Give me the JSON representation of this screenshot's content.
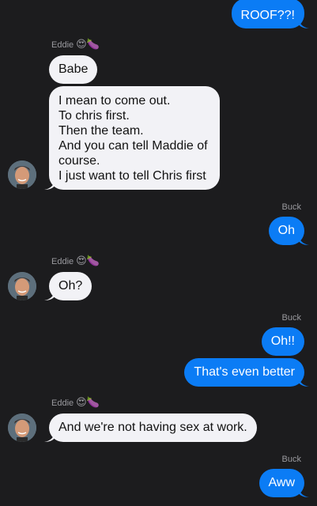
{
  "messages": [
    {
      "side": "out",
      "text": "ROOF??!"
    },
    {
      "sender": "Eddie",
      "sender_emoji": "😍🍆",
      "side": "in",
      "text": "Babe"
    },
    {
      "side": "in",
      "lines": [
        "I mean to come out.",
        "To chris first.",
        "Then the team.",
        "And you can tell Maddie of",
        "course.",
        "I just want to tell Chris first"
      ]
    },
    {
      "sender": "Buck",
      "side": "out",
      "text": "Oh"
    },
    {
      "sender": "Eddie",
      "sender_emoji": "😍🍆",
      "side": "in",
      "text": "Oh?"
    },
    {
      "sender": "Buck",
      "side": "out",
      "text": "Oh!!"
    },
    {
      "side": "out",
      "text": "That's even better"
    },
    {
      "sender": "Eddie",
      "sender_emoji": "😍🍆",
      "side": "in",
      "text": "And we're not having sex at work."
    },
    {
      "sender": "Buck",
      "side": "out",
      "text": "Aww"
    }
  ],
  "colors": {
    "background": "#1c1c1e",
    "incoming_bubble": "#f2f2f6",
    "outgoing_bubble": "#0b7cf5",
    "sender_label": "#9a9a9f"
  }
}
